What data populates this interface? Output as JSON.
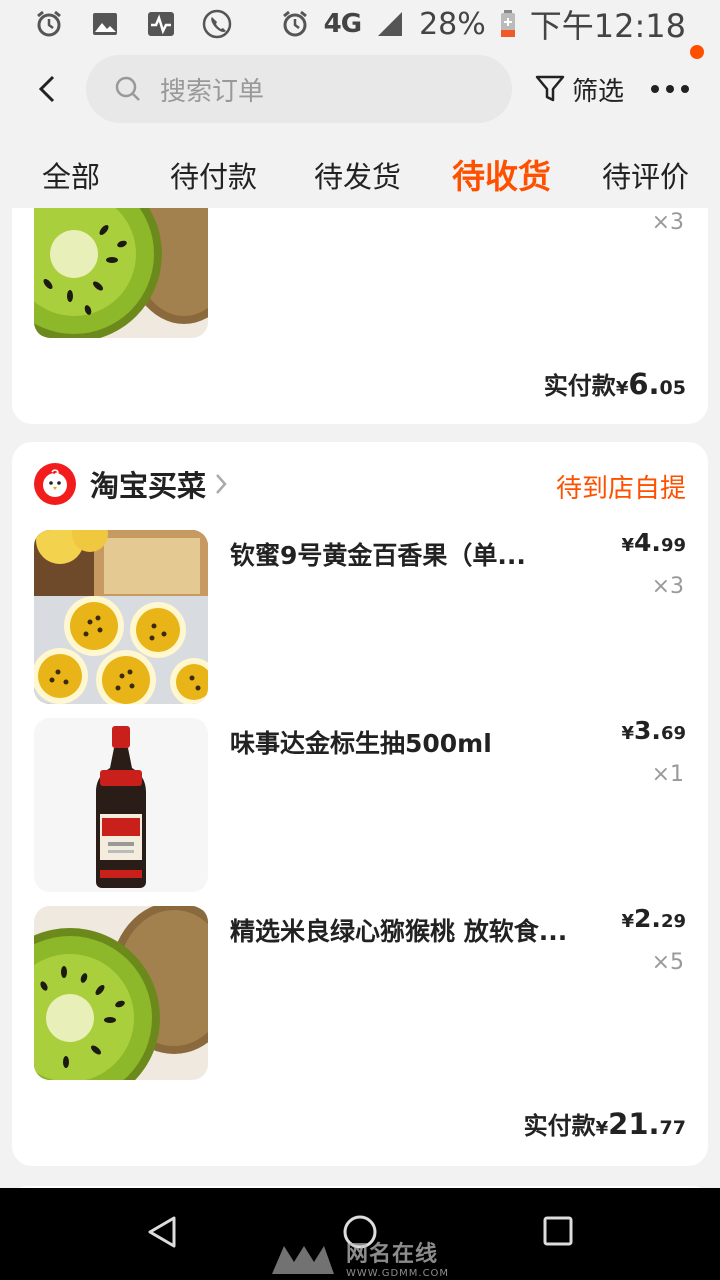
{
  "status_bar": {
    "network": "4G",
    "battery": "28%",
    "time": "下午12:18"
  },
  "header": {
    "search_placeholder": "搜索订单",
    "filter_label": "筛选"
  },
  "tabs": [
    {
      "label": "全部",
      "active": false
    },
    {
      "label": "待付款",
      "active": false
    },
    {
      "label": "待发货",
      "active": false
    },
    {
      "label": "待收货",
      "active": true
    },
    {
      "label": "待评价",
      "active": false
    }
  ],
  "order_prev": {
    "item_qty": "×3",
    "total_label": "实付款",
    "total_yen": "¥",
    "total_int": "6.",
    "total_dec": "05"
  },
  "order_main": {
    "shop_name": "淘宝买菜",
    "status": "待到店自提",
    "items": [
      {
        "title": "钦蜜9号黄金百香果（单...",
        "yen": "¥",
        "price_int": "4.",
        "price_dec": "99",
        "qty": "×3",
        "image": "passion-fruit"
      },
      {
        "title": "味事达金标生抽500ml",
        "yen": "¥",
        "price_int": "3.",
        "price_dec": "69",
        "qty": "×1",
        "image": "soy-sauce-bottle"
      },
      {
        "title": "精选米良绿心猕猴桃 放软食...",
        "yen": "¥",
        "price_int": "2.",
        "price_dec": "29",
        "qty": "×5",
        "image": "kiwi"
      }
    ],
    "total_label": "实付款",
    "total_yen": "¥",
    "total_int": "21.",
    "total_dec": "77"
  },
  "watermark": {
    "text": "网名在线",
    "sub": "WWW.GDMM.COM"
  },
  "colors": {
    "accent": "#ff5000",
    "background": "#f2f2f2",
    "card": "#ffffff"
  }
}
